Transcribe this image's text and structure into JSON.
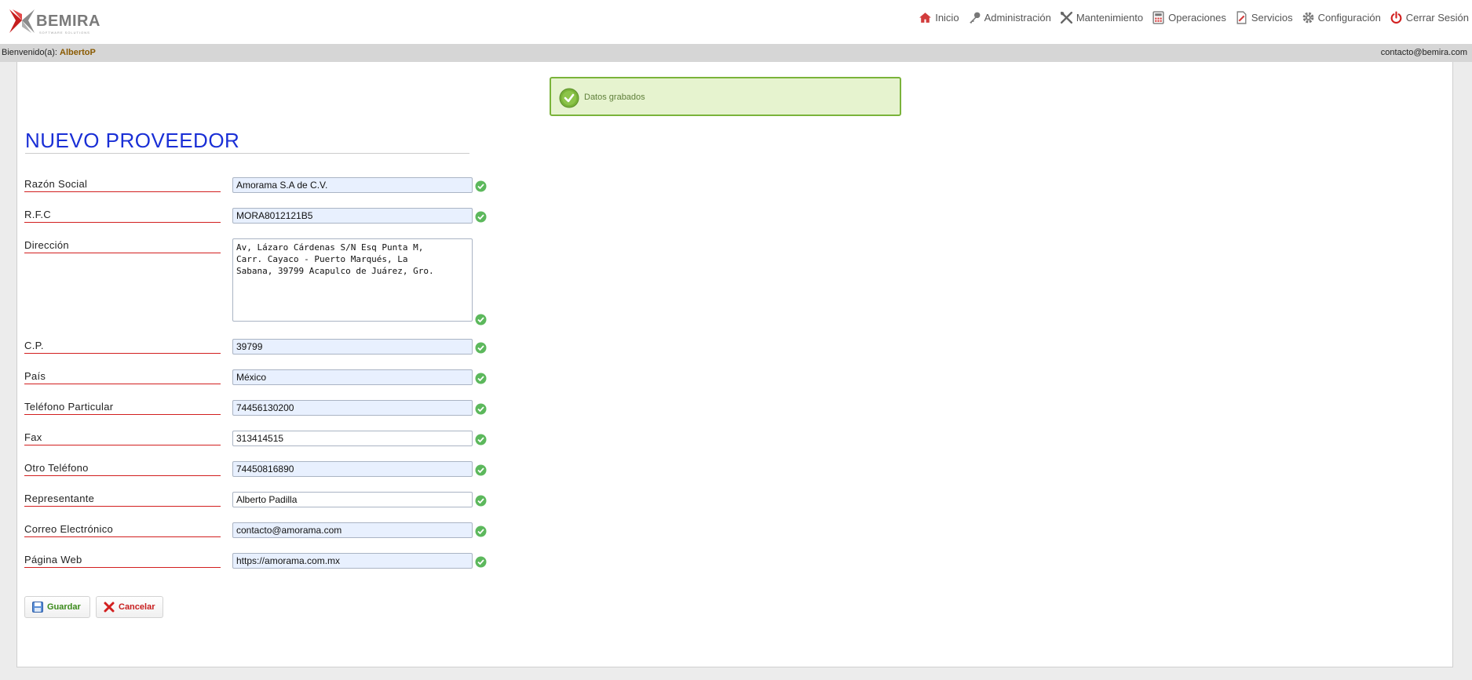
{
  "brand": {
    "name": "BEMIRA",
    "tagline": "SOFTWARE SOLUTIONS"
  },
  "nav": [
    {
      "label": "Inicio",
      "icon": "home-icon"
    },
    {
      "label": "Administración",
      "icon": "key-icon"
    },
    {
      "label": "Mantenimiento",
      "icon": "tools-icon"
    },
    {
      "label": "Operaciones",
      "icon": "calculator-icon"
    },
    {
      "label": "Servicios",
      "icon": "document-edit-icon"
    },
    {
      "label": "Configuración",
      "icon": "gear-icon"
    },
    {
      "label": "Cerrar Sesión",
      "icon": "power-icon"
    }
  ],
  "welcome": {
    "prefix": "Bienvenido(a):",
    "user": "AlbertoP",
    "email": "contacto@bemira.com"
  },
  "notice": {
    "message": "Datos grabados"
  },
  "form": {
    "title": "NUEVO PROVEEDOR",
    "fields": [
      {
        "label": "Razón Social",
        "value": "Amorama S.A de C.V."
      },
      {
        "label": "R.F.C",
        "value": "MORA8012121B5"
      },
      {
        "label": "Dirección",
        "value": "Av, Lázaro Cárdenas S/N Esq Punta M,\nCarr. Cayaco - Puerto Marqués, La\nSabana, 39799 Acapulco de Juárez, Gro."
      },
      {
        "label": "C.P.",
        "value": "39799"
      },
      {
        "label": "País",
        "value": "México"
      },
      {
        "label": "Teléfono Particular",
        "value": "74456130200"
      },
      {
        "label": "Fax",
        "value": "313414515"
      },
      {
        "label": "Otro Teléfono",
        "value": "74450816890"
      },
      {
        "label": "Representante",
        "value": "Alberto Padilla"
      },
      {
        "label": "Correo Electrónico",
        "value": "contacto@amorama.com"
      },
      {
        "label": "Página Web",
        "value": "https://amorama.com.mx"
      }
    ]
  },
  "buttons": {
    "save": "Guardar",
    "cancel": "Cancelar"
  },
  "colors": {
    "title": "#1a2fd6",
    "label_underline": "#d21f1f",
    "notice_bg": "#e6f3cf",
    "notice_border": "#7ab33a",
    "valid_check": "#5cb85c"
  }
}
